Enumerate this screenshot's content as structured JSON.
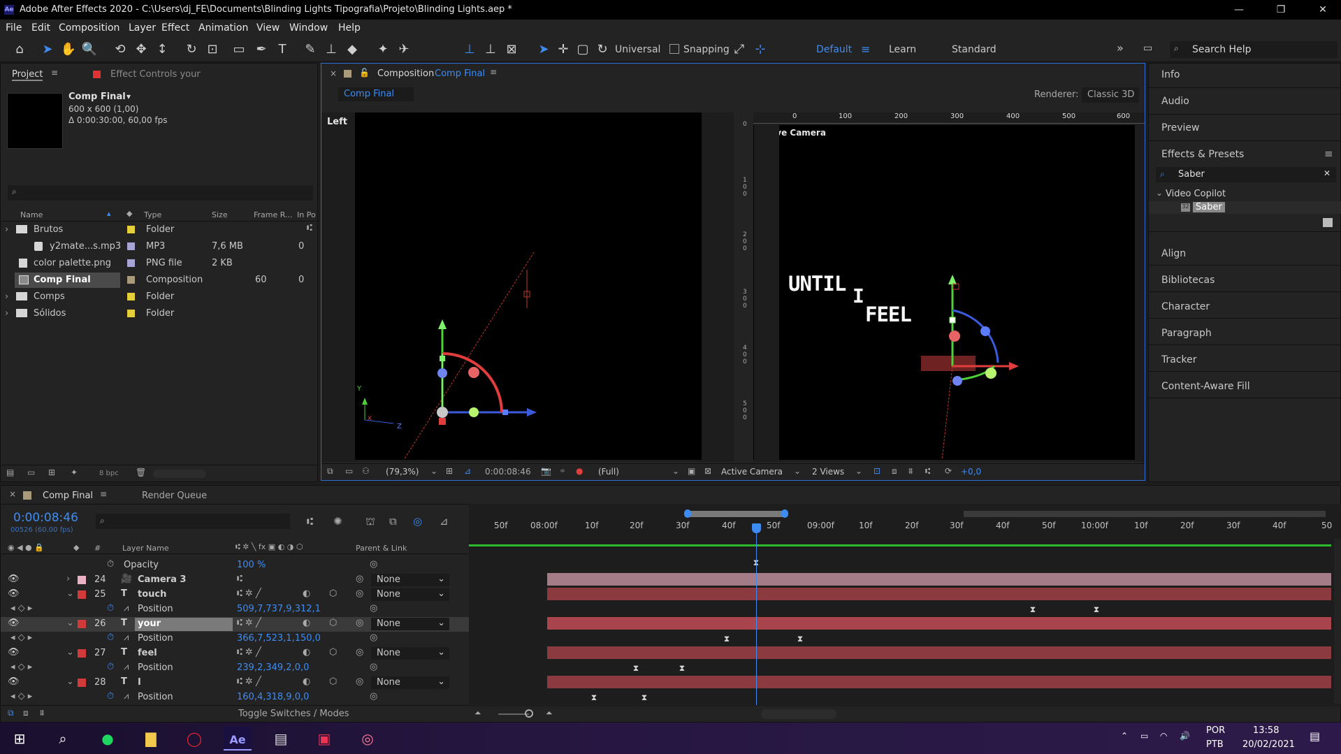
{
  "window": {
    "title": "Adobe After Effects 2020 - C:\\Users\\dj_FE\\Documents\\Blinding Lights Tipografia\\Projeto\\Blinding Lights.aep *",
    "logo": "Ae",
    "controls": [
      "—",
      "❐",
      "✕"
    ]
  },
  "menu": [
    "File",
    "Edit",
    "Composition",
    "Layer",
    "Effect",
    "Animation",
    "View",
    "Window",
    "Help"
  ],
  "toolbar": {
    "universal": "Universal",
    "snapping": "Snapping",
    "workspaces": [
      "Default",
      "Learn",
      "Standard"
    ],
    "search_placeholder": "Search Help"
  },
  "project_panel": {
    "tab_project": "Project",
    "tab_effect_controls": "Effect Controls your",
    "comp_name": "Comp Final",
    "comp_info1": "600 x 600 (1,00)",
    "comp_info2": "Δ 0:00:30:00, 60,00 fps",
    "columns": [
      "Name",
      "Type",
      "Size",
      "Frame R...",
      "In Po"
    ],
    "items": [
      {
        "name": "Brutos",
        "type": "Folder",
        "size": "",
        "fr": "",
        "in": ""
      },
      {
        "name": "y2mate...s.mp3",
        "type": "MP3",
        "size": "7,6 MB",
        "fr": "",
        "in": "0"
      },
      {
        "name": "color palette.png",
        "type": "PNG file",
        "size": "2 KB",
        "fr": "",
        "in": ""
      },
      {
        "name": "Comp Final",
        "type": "Composition",
        "size": "",
        "fr": "60",
        "in": "0"
      },
      {
        "name": "Comps",
        "type": "Folder",
        "size": "",
        "fr": "",
        "in": ""
      },
      {
        "name": "Sólidos",
        "type": "Folder",
        "size": "",
        "fr": "",
        "in": ""
      }
    ],
    "bpc": "8 bpc"
  },
  "composition": {
    "tab_label": "Composition",
    "tab_comp": "Comp Final",
    "subtab": "Comp Final",
    "renderer_label": "Renderer:",
    "renderer_value": "Classic 3D",
    "left_view_label": "Left",
    "active_camera_label": "Active Camera",
    "ruler": [
      "0",
      "100",
      "200",
      "300",
      "400",
      "500",
      "600"
    ],
    "vruler": [
      "0",
      "1 0 0",
      "2 0 0",
      "3 0 0",
      "4 0 0",
      "5 0 0"
    ],
    "text_lines": [
      "UNTIL",
      "I",
      "FEEL"
    ],
    "bottom": {
      "zoom": "(79,3%)",
      "timecode": "0:00:08:46",
      "resolution": "(Full)",
      "view": "Active Camera",
      "views": "2 Views",
      "exposure": "+0,0"
    }
  },
  "right_panel": {
    "items_top": [
      "Info",
      "Audio",
      "Preview"
    ],
    "effects_title": "Effects & Presets",
    "effects_search": "Saber",
    "category": "Video Copilot",
    "effect": "Saber",
    "items_bottom": [
      "Align",
      "Bibliotecas",
      "Character",
      "Paragraph",
      "Tracker",
      "Content-Aware Fill"
    ]
  },
  "timeline": {
    "tab_comp": "Comp Final",
    "tab_render": "Render Queue",
    "timecode": "0:00:08:46",
    "timecode_sub": "00526 (60.00 fps)",
    "col_layer_name": "Layer Name",
    "col_parent": "Parent & Link",
    "ruler": [
      "50f",
      "08:00f",
      "10f",
      "20f",
      "30f",
      "40f",
      "50f",
      "09:00f",
      "10f",
      "20f",
      "30f",
      "40f",
      "50f",
      "10:00f",
      "10f",
      "20f",
      "30f",
      "40f",
      "50"
    ],
    "rows": [
      {
        "num": "",
        "name": "Opacity",
        "value": "100 %",
        "kind": "prop"
      },
      {
        "num": "24",
        "name": "Camera 3",
        "value": "",
        "kind": "layer",
        "parent": "None"
      },
      {
        "num": "25",
        "name": "touch",
        "value": "",
        "kind": "layer",
        "parent": "None"
      },
      {
        "num": "",
        "name": "Position",
        "value": "509,7,737,9,312,1",
        "kind": "prop"
      },
      {
        "num": "26",
        "name": "your",
        "value": "",
        "kind": "layer",
        "parent": "None"
      },
      {
        "num": "",
        "name": "Position",
        "value": "366,7,523,1,150,0",
        "kind": "prop"
      },
      {
        "num": "27",
        "name": "feel",
        "value": "",
        "kind": "layer",
        "parent": "None"
      },
      {
        "num": "",
        "name": "Position",
        "value": "239,2,349,2,0,0",
        "kind": "prop"
      },
      {
        "num": "28",
        "name": "I",
        "value": "",
        "kind": "layer",
        "parent": "None"
      },
      {
        "num": "",
        "name": "Position",
        "value": "160,4,318,9,0,0",
        "kind": "prop"
      }
    ],
    "toggle_label": "Toggle Switches / Modes"
  },
  "taskbar": {
    "lang1": "POR",
    "lang2": "PTB",
    "time": "13:58",
    "date": "20/02/2021"
  }
}
